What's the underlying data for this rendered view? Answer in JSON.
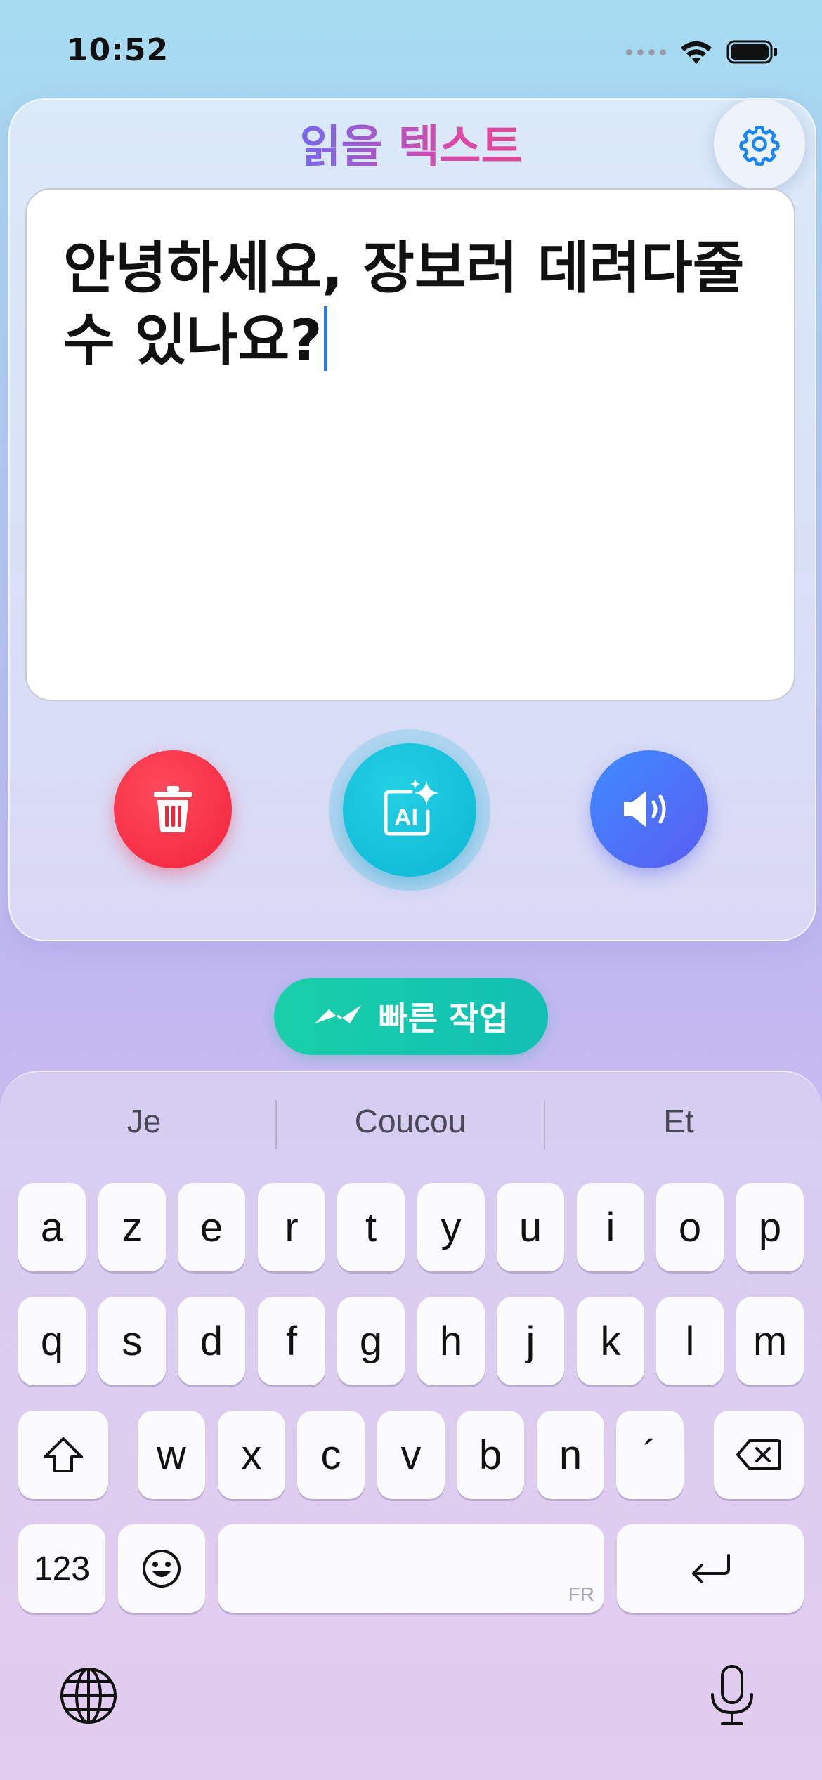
{
  "status": {
    "time": "10:52"
  },
  "card": {
    "title": "읽을 텍스트",
    "text": "안녕하세요, 장보러 데려다줄 수 있나요?",
    "icons": {
      "settings": "gear-icon",
      "delete": "trash-icon",
      "ai": "ai-sparkle-icon",
      "speak": "speaker-icon"
    }
  },
  "quick_action": {
    "label": "빠른 작업"
  },
  "keyboard": {
    "suggestions": [
      "Je",
      "Coucou",
      "Et"
    ],
    "row1": [
      "a",
      "z",
      "e",
      "r",
      "t",
      "y",
      "u",
      "i",
      "o",
      "p"
    ],
    "row2": [
      "q",
      "s",
      "d",
      "f",
      "g",
      "h",
      "j",
      "k",
      "l",
      "m"
    ],
    "row3": [
      "w",
      "x",
      "c",
      "v",
      "b",
      "n",
      "´"
    ],
    "numbers_label": "123",
    "space_lang": "FR"
  },
  "colors": {
    "delete": "#f2243c",
    "ai": "#0cb6d4",
    "speak": "#4a78f8",
    "quick": "#19c9ab",
    "caret": "#1a7df0"
  }
}
